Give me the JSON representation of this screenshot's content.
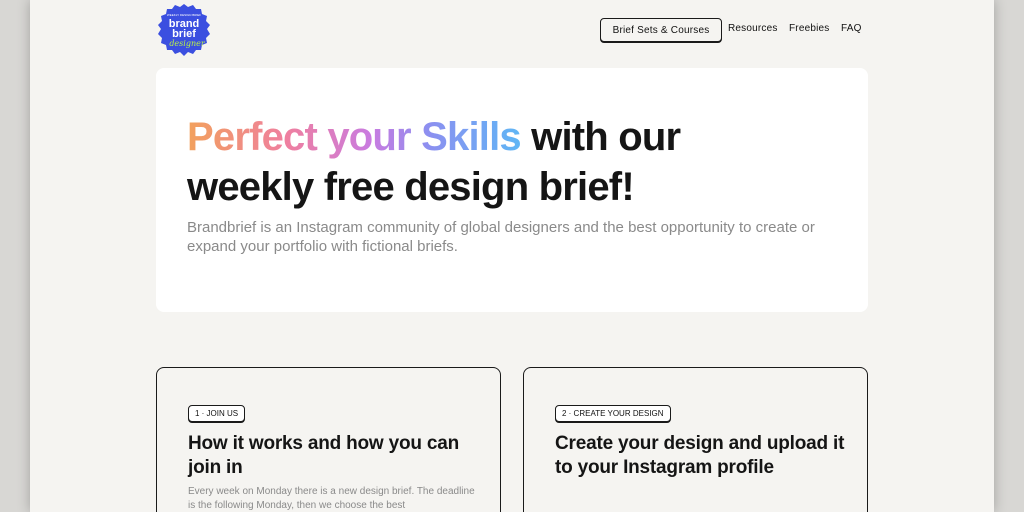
{
  "header": {
    "logo": {
      "line1": "brand",
      "line2": "brief",
      "script": "designer",
      "top_text": "WEEKLY DESIGN BRIEF",
      "color": "#3b4fe0"
    },
    "nav": {
      "cta_label": "Brief Sets & Courses",
      "resources_label": "Resources",
      "freebies_label": "Freebies",
      "faq_label": "FAQ"
    }
  },
  "hero": {
    "title_highlight": "Perfect your Skills",
    "title_rest_1": " with our",
    "title_rest_2": "weekly free design brief!",
    "subtitle": "Brandbrief is an Instagram community of global designers and the best opportunity to create or expand your portfolio with fictional briefs."
  },
  "cards": [
    {
      "badge": "1 · JOIN US",
      "title": "How it works and how you can join in",
      "text": "Every week on Monday there is a new design brief. The deadline is the following Monday, then we choose the best"
    },
    {
      "badge": "2 · CREATE YOUR DESIGN",
      "title": "Create your design and upload it to your Instagram profile",
      "text": ""
    }
  ]
}
